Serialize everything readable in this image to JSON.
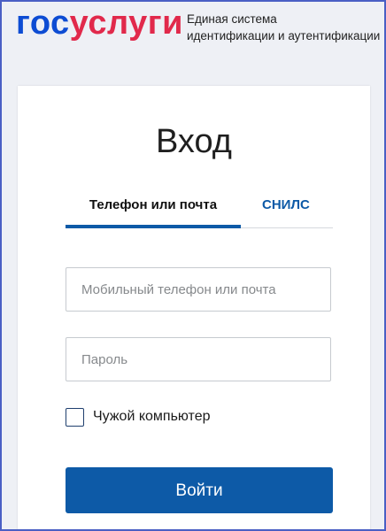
{
  "header": {
    "logo_part1": "гос",
    "logo_part2": "услуги",
    "tagline": "Единая система\nидентификации и аутентификации"
  },
  "login": {
    "title": "Вход",
    "tabs": [
      {
        "label": "Телефон или почта",
        "active": true
      },
      {
        "label": "СНИЛС",
        "active": false
      }
    ],
    "login_field": {
      "placeholder": "Мобильный телефон или почта",
      "value": ""
    },
    "password_field": {
      "placeholder": "Пароль",
      "value": ""
    },
    "checkbox": {
      "label": "Чужой компьютер",
      "checked": false
    },
    "submit_label": "Войти"
  },
  "colors": {
    "brand_blue": "#0d4cd3",
    "brand_red": "#e1294b",
    "accent": "#0d5aa7",
    "frame_border": "#4a5fc4"
  }
}
